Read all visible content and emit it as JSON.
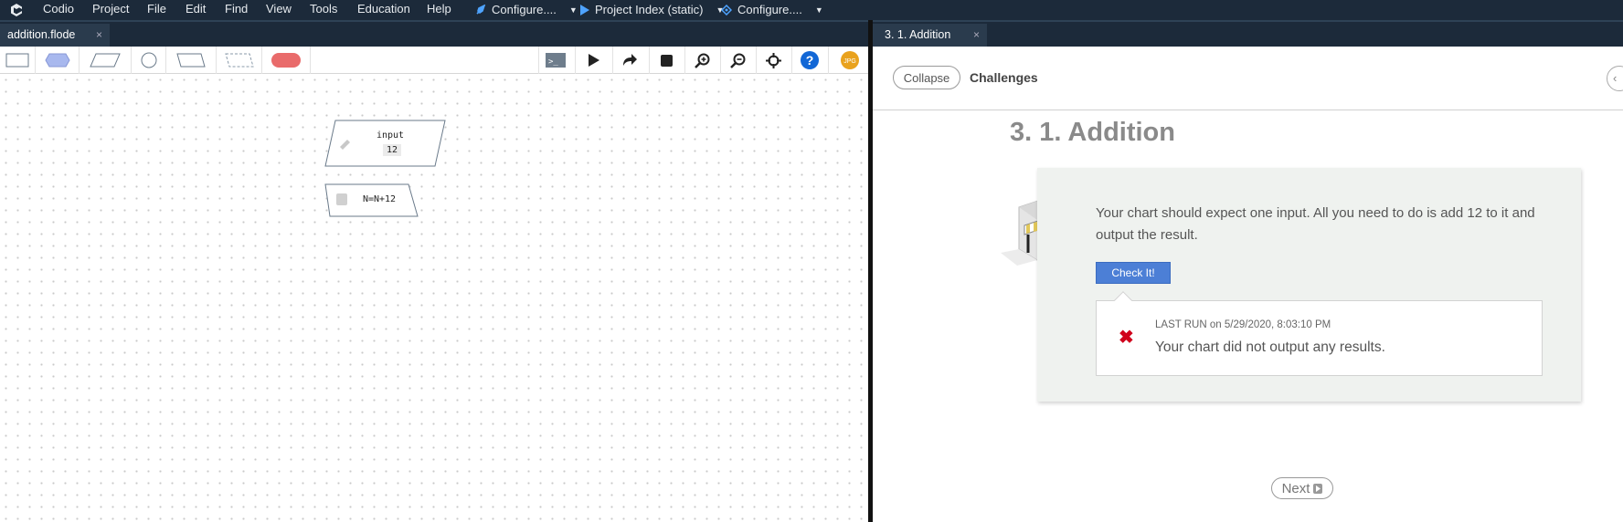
{
  "menubar": {
    "items": [
      "Codio",
      "Project",
      "File",
      "Edit",
      "Find",
      "View",
      "Tools",
      "Education",
      "Help"
    ],
    "configure_1": "Configure....",
    "project_index": "Project Index (static)",
    "configure_2": "Configure...."
  },
  "left_pane": {
    "file_tab": "addition.flode",
    "close": "×"
  },
  "toolbar": {
    "jpg_label": "JPG",
    "help_label": "?"
  },
  "flowchart": {
    "input_node": {
      "label": "input",
      "value": "12"
    },
    "process_node": {
      "label": "N=N+12"
    }
  },
  "right_pane": {
    "guide_tab": "3. 1. Addition",
    "close": "×",
    "collapse": "Collapse",
    "challenges": "Challenges",
    "back": "‹",
    "title": "3. 1. Addition",
    "challenge_text": "Your chart should expect one input. All you need to do is add 12 to it and output the result.",
    "check_button": "Check It!",
    "last_run_label": "LAST RUN",
    "last_run_on": "on 5/29/2020, 8:03:10 PM",
    "result_message": "Your chart did not output any results.",
    "next": "Next"
  },
  "colors": {
    "menubar_bg": "#1c2a3a",
    "check_button": "#4c7fd6",
    "fail_icon": "#d0021b",
    "stop_shape": "#e96b6b",
    "terminal_shape": "#a8b8ee"
  }
}
